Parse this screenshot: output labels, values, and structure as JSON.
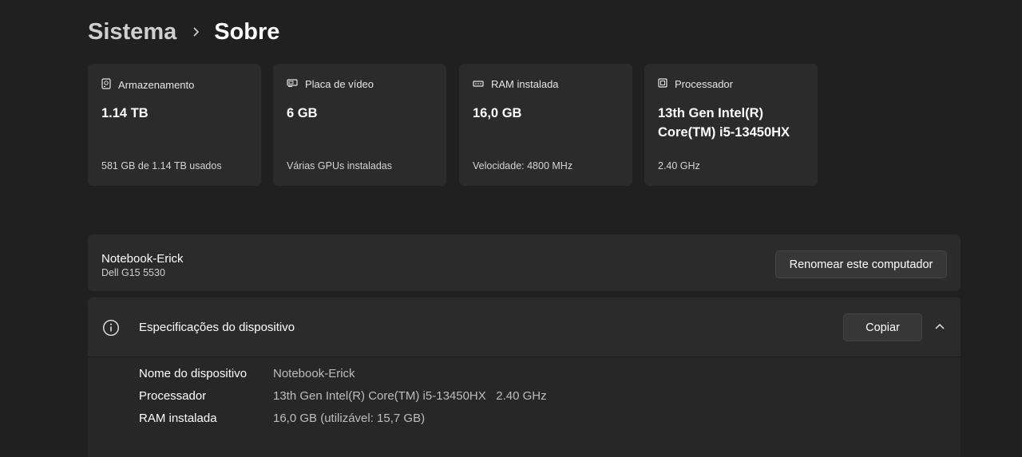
{
  "breadcrumb": {
    "parent": "Sistema",
    "current": "Sobre"
  },
  "cards": [
    {
      "icon": "storage-icon",
      "title": "Armazenamento",
      "value": "1.14 TB",
      "detail": "581 GB de 1.14 TB usados"
    },
    {
      "icon": "gpu-icon",
      "title": "Placa de vídeo",
      "value": "6 GB",
      "detail": "Várias GPUs instaladas"
    },
    {
      "icon": "ram-icon",
      "title": "RAM instalada",
      "value": "16,0 GB",
      "detail": "Velocidade: 4800 MHz"
    },
    {
      "icon": "processor-icon",
      "title": "Processador",
      "value": "13th Gen Intel(R) Core(TM) i5-13450HX",
      "detail": "2.40 GHz"
    }
  ],
  "device": {
    "name": "Notebook-Erick",
    "model": "Dell G15 5530",
    "rename_label": "Renomear este computador"
  },
  "specs": {
    "title": "Especificações do dispositivo",
    "copy_label": "Copiar",
    "rows": [
      {
        "label": "Nome do dispositivo",
        "value": "Notebook-Erick"
      },
      {
        "label": "Processador",
        "value": "13th Gen Intel(R) Core(TM) i5-13450HX   2.40 GHz"
      },
      {
        "label": "RAM instalada",
        "value": "16,0 GB (utilizável: 15,7 GB)"
      }
    ]
  },
  "colors": {
    "background": "#202020",
    "card": "#2b2b2b",
    "button": "#373737"
  }
}
